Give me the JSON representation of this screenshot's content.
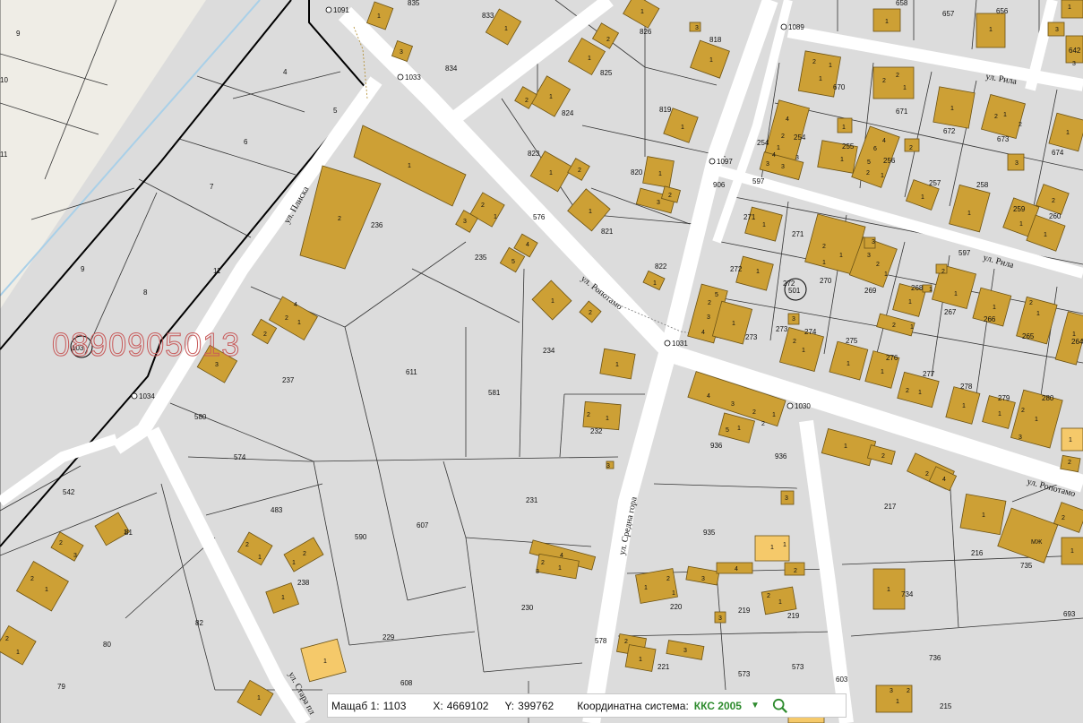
{
  "watermark": {
    "phone": "0890905013"
  },
  "circle_label": "501",
  "circle_label_left": "103",
  "status_bar": {
    "scale_label": "Мащаб 1:",
    "scale_value": "1103",
    "x_label": "X:",
    "x_value": "4669102",
    "y_label": "Y:",
    "y_value": "399762",
    "crs_label": "Координатна система:",
    "crs_value": "ККС 2005",
    "dropdown_icon": "triangle-down-icon",
    "search_icon": "magnifier-icon"
  },
  "streets": {
    "plisca": "ул. Плиска",
    "ropotamo_1": "ул. Ропотамо",
    "ropotamo_2": "ул. Ропотамо",
    "sredna_gora": "ул. Средна гора",
    "rila_1": "ул. Рила",
    "rila_2": "ул. Рила",
    "stara_planina": "ул. Стара пл"
  },
  "survey_points": {
    "p1091": "1091",
    "p1033": "1033",
    "p1034": "1034",
    "p1089": "1089",
    "p1097": "1097",
    "p1031": "1031",
    "p1030": "1030"
  },
  "parcels": {
    "p9a": "9",
    "p10": "10",
    "p11a": "11",
    "p4": "4",
    "p5": "5",
    "p6": "6",
    "p7": "7",
    "p9b": "9",
    "p8": "8",
    "p11b": "11",
    "p835": "835",
    "p833": "833",
    "p834": "834",
    "p826": "826",
    "p818": "818",
    "p825": "825",
    "p824": "824",
    "p819": "819",
    "p823": "823",
    "p820": "820",
    "p821": "821",
    "p822": "822",
    "p906": "906",
    "p576": "576",
    "p236": "236",
    "p235": "235",
    "p237": "237",
    "p611": "611",
    "p581": "581",
    "p234": "234",
    "p232": "232",
    "p580": "580",
    "p574": "574",
    "p542": "542",
    "p483": "483",
    "p590": "590",
    "p607": "607",
    "p231": "231",
    "p238": "238",
    "p81": "81",
    "p82": "82",
    "p80": "80",
    "p79": "79",
    "p229": "229",
    "p230": "230",
    "p578": "578",
    "p608": "608",
    "p936a": "936",
    "p936b": "936",
    "p935": "935",
    "p220": "220",
    "p219a": "219",
    "p219b": "219",
    "p221": "221",
    "p573a": "573",
    "p573b": "573",
    "p603": "603",
    "p217": "217",
    "p216": "216",
    "p735": "735",
    "p734": "734",
    "p693": "693",
    "p736": "736",
    "p215": "215",
    "p658": "658",
    "p657": "657",
    "p656": "656",
    "p642": "642",
    "p670": "670",
    "p671": "671",
    "p672": "672",
    "p673": "673",
    "p674": "674",
    "p254a": "254",
    "p254b": "254",
    "p255": "255",
    "p256": "256",
    "p257": "257",
    "p258": "258",
    "p259": "259",
    "p260": "260",
    "p597a": "597",
    "p597b": "597",
    "p271a": "271",
    "p271b": "271",
    "p272a": "272",
    "p272b": "272",
    "p270": "270",
    "p269": "269",
    "p268": "268",
    "p267": "267",
    "p266": "266",
    "p265": "265",
    "p264": "264",
    "p273a": "273",
    "p273b": "273",
    "p274": "274",
    "p275": "275",
    "p276": "276",
    "p277": "277",
    "p278": "278",
    "p279": "279",
    "p280": "280"
  },
  "colors": {
    "building": "#cda035",
    "building_light": "#f5c96a",
    "parcel": "#dcdcdc",
    "road": "#ffffff",
    "field": "#efede6",
    "crs": "#2e8b2e",
    "watermark": "#c85a5a"
  }
}
